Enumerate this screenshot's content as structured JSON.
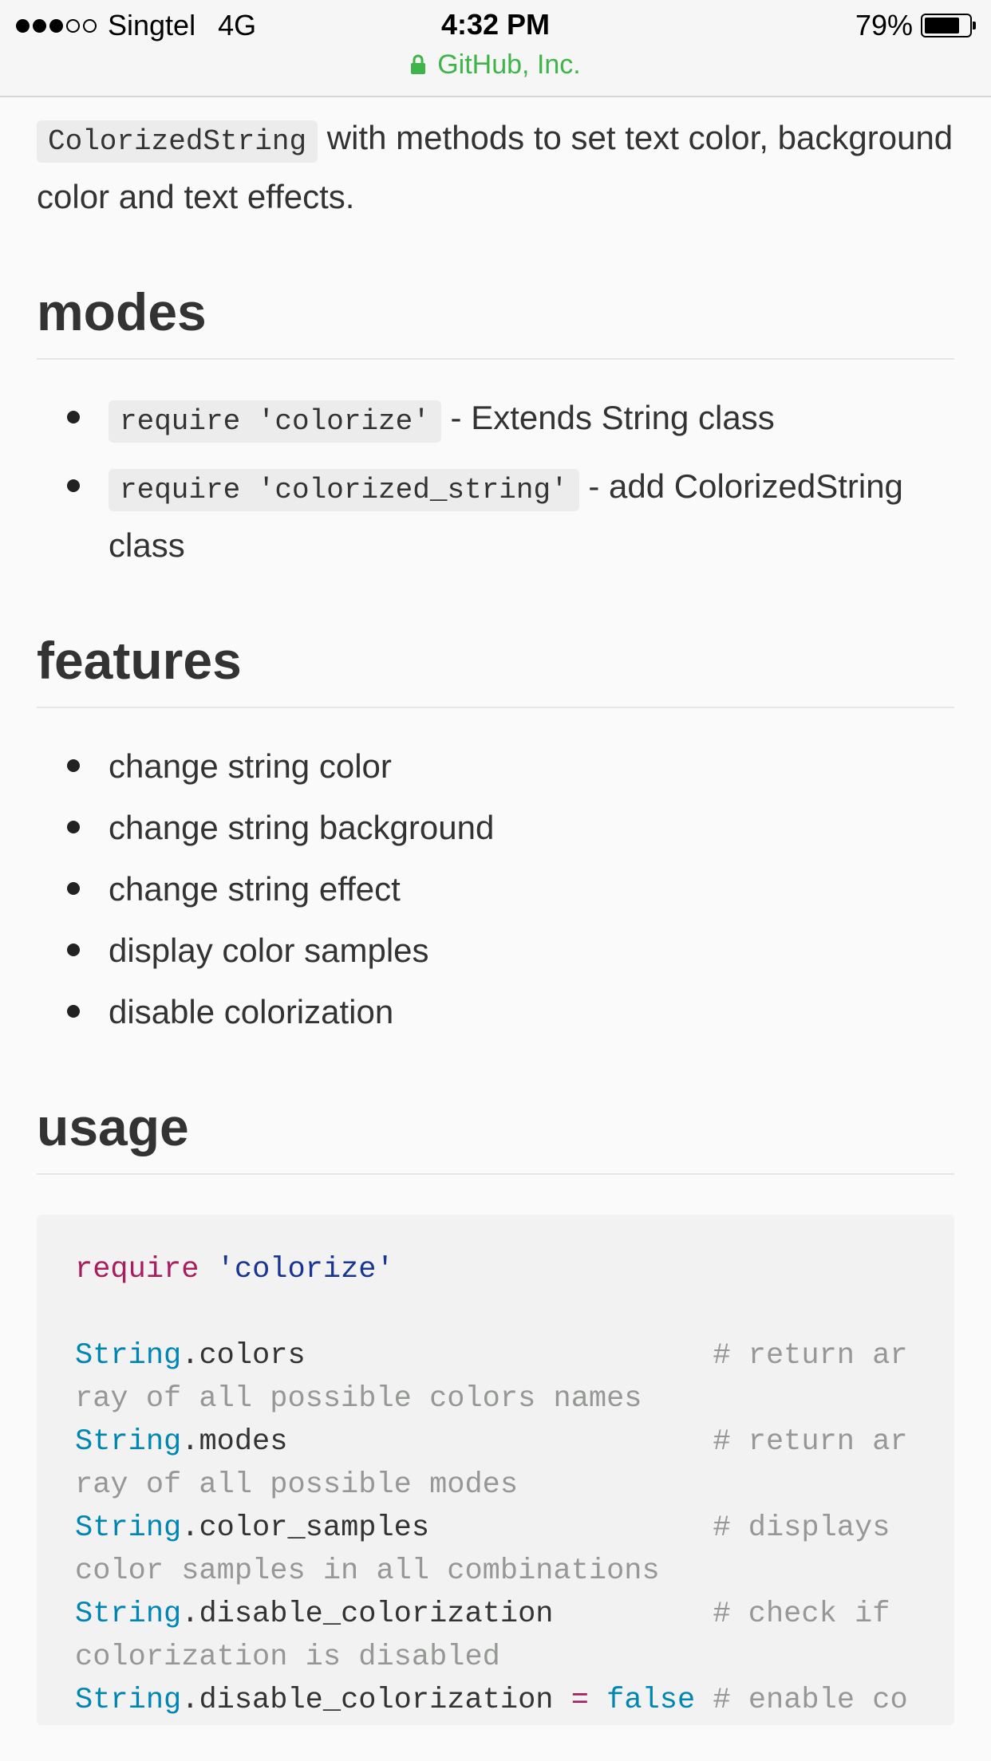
{
  "status": {
    "carrier": "Singtel",
    "network": "4G",
    "time": "4:32 PM",
    "battery": "79%",
    "battery_level": 0.79
  },
  "url_bar": {
    "site": "GitHub, Inc."
  },
  "intro": {
    "code": "ColorizedString",
    "text": "with methods to set text color, background color and text effects."
  },
  "modes": {
    "heading": "modes",
    "items": [
      {
        "code": "require 'colorize'",
        "text": "- Extends String class"
      },
      {
        "code": "require 'colorized_string'",
        "text": "- add ColorizedString class"
      }
    ]
  },
  "features": {
    "heading": "features",
    "items": [
      "change string color",
      "change string background",
      "change string effect",
      "display color samples",
      "disable colorization"
    ]
  },
  "usage": {
    "heading": "usage",
    "code": {
      "require_kw": "require",
      "require_arg": "'colorize'",
      "lines": [
        {
          "cls": "String",
          "method": ".colors",
          "pad": "                       ",
          "comment": "# return array of all possible colors names"
        },
        {
          "cls": "String",
          "method": ".modes",
          "pad": "                        ",
          "comment": "# return array of all possible modes"
        },
        {
          "cls": "String",
          "method": ".color_samples",
          "pad": "                ",
          "comment": "# displays color samples in all combinations"
        },
        {
          "cls": "String",
          "method": ".disable_colorization",
          "pad": "         ",
          "comment": "# check if colorization is disabled"
        }
      ],
      "last_line": {
        "cls": "String",
        "method": ".disable_colorization ",
        "op": "=",
        "value": "false",
        "comment": "# enable colorization"
      }
    }
  },
  "colors": {
    "keyword": "#a71d5d",
    "string": "#183691",
    "constant": "#0086b3",
    "comment": "#969896",
    "url_green": "#3fb44a"
  }
}
